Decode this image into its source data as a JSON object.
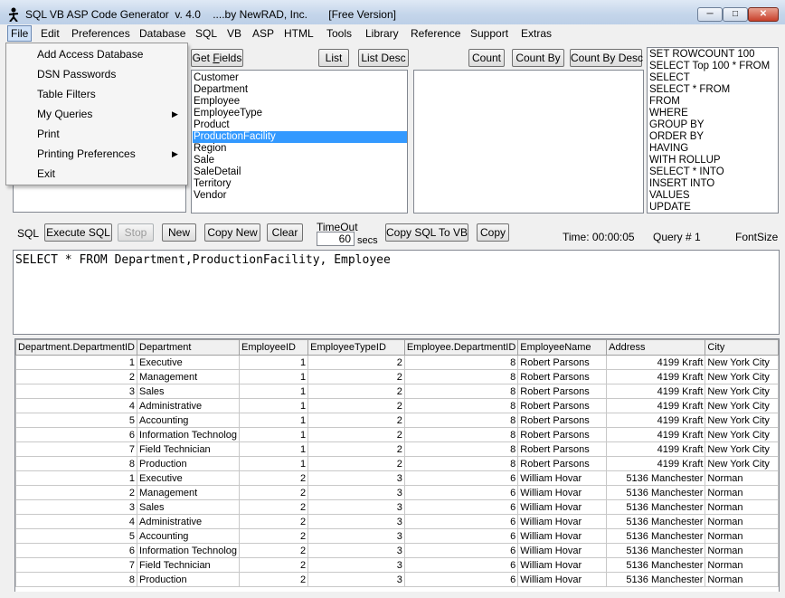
{
  "window": {
    "title": "SQL VB ASP Code Generator  v. 4.0    ....by NewRAD, Inc.       [Free Version]"
  },
  "menubar": [
    "File",
    "Edit",
    "Preferences",
    "Database",
    "SQL",
    "VB",
    "ASP",
    "HTML",
    "Tools",
    "Library",
    "Reference",
    "Support",
    "Extras"
  ],
  "file_menu": [
    {
      "label": "Add Access Database",
      "submenu": false
    },
    {
      "label": "DSN Passwords",
      "submenu": false
    },
    {
      "label": "Table Filters",
      "submenu": false
    },
    {
      "label": "My Queries",
      "submenu": true
    },
    {
      "label": "Print",
      "submenu": false
    },
    {
      "label": "Printing Preferences",
      "submenu": true
    },
    {
      "label": "Exit",
      "submenu": false
    }
  ],
  "toolbar": {
    "get_fields": "Get Fields",
    "list": "List",
    "list_desc": "List Desc",
    "count": "Count",
    "count_by": "Count By",
    "count_by_desc": "Count By Desc"
  },
  "tables": [
    "Customer",
    "Department",
    "Employee",
    "EmployeeType",
    "Product",
    "ProductionFacility",
    "Region",
    "Sale",
    "SaleDetail",
    "Territory",
    "Vendor"
  ],
  "selected_table": "ProductionFacility",
  "keywords": [
    "SET ROWCOUNT 100",
    "SELECT Top 100 * FROM",
    "SELECT",
    "SELECT * FROM",
    "FROM",
    "WHERE",
    "GROUP BY",
    "ORDER BY",
    "HAVING",
    "WITH ROLLUP",
    "SELECT * INTO",
    "INSERT INTO",
    "VALUES",
    "UPDATE"
  ],
  "sql_bar": {
    "sql_label": "SQL",
    "execute": "Execute SQL",
    "stop": "Stop",
    "new": "New",
    "copy_new": "Copy New",
    "clear": "Clear",
    "timeout_label": "TimeOut",
    "timeout_value": "60",
    "secs": "secs",
    "copy_sql_vb": "Copy SQL To VB",
    "copy": "Copy",
    "time": "Time:  00:00:05",
    "query_no": "Query #  1",
    "fontsize": "FontSize"
  },
  "query_text": "SELECT * FROM Department,ProductionFacility, Employee",
  "grid": {
    "columns": [
      "Department.DepartmentID",
      "Department",
      "EmployeeID",
      "EmployeeTypeID",
      "Employee.DepartmentID",
      "EmployeeName",
      "Address",
      "City"
    ],
    "rows": [
      [
        "1",
        "Executive",
        "1",
        "2",
        "8",
        "Robert Parsons",
        "4199 Kraft",
        "New York City"
      ],
      [
        "2",
        "Management",
        "1",
        "2",
        "8",
        "Robert Parsons",
        "4199 Kraft",
        "New York City"
      ],
      [
        "3",
        "Sales",
        "1",
        "2",
        "8",
        "Robert Parsons",
        "4199 Kraft",
        "New York City"
      ],
      [
        "4",
        "Administrative",
        "1",
        "2",
        "8",
        "Robert Parsons",
        "4199 Kraft",
        "New York City"
      ],
      [
        "5",
        "Accounting",
        "1",
        "2",
        "8",
        "Robert Parsons",
        "4199 Kraft",
        "New York City"
      ],
      [
        "6",
        "Information Technolog",
        "1",
        "2",
        "8",
        "Robert Parsons",
        "4199 Kraft",
        "New York City"
      ],
      [
        "7",
        "Field Technician",
        "1",
        "2",
        "8",
        "Robert Parsons",
        "4199 Kraft",
        "New York City"
      ],
      [
        "8",
        "Production",
        "1",
        "2",
        "8",
        "Robert Parsons",
        "4199 Kraft",
        "New York City"
      ],
      [
        "1",
        "Executive",
        "2",
        "3",
        "6",
        "William Hovar",
        "5136 Manchester",
        "Norman"
      ],
      [
        "2",
        "Management",
        "2",
        "3",
        "6",
        "William Hovar",
        "5136 Manchester",
        "Norman"
      ],
      [
        "3",
        "Sales",
        "2",
        "3",
        "6",
        "William Hovar",
        "5136 Manchester",
        "Norman"
      ],
      [
        "4",
        "Administrative",
        "2",
        "3",
        "6",
        "William Hovar",
        "5136 Manchester",
        "Norman"
      ],
      [
        "5",
        "Accounting",
        "2",
        "3",
        "6",
        "William Hovar",
        "5136 Manchester",
        "Norman"
      ],
      [
        "6",
        "Information Technolog",
        "2",
        "3",
        "6",
        "William Hovar",
        "5136 Manchester",
        "Norman"
      ],
      [
        "7",
        "Field Technician",
        "2",
        "3",
        "6",
        "William Hovar",
        "5136 Manchester",
        "Norman"
      ],
      [
        "8",
        "Production",
        "2",
        "3",
        "6",
        "William Hovar",
        "5136 Manchester",
        "Norman"
      ]
    ]
  }
}
